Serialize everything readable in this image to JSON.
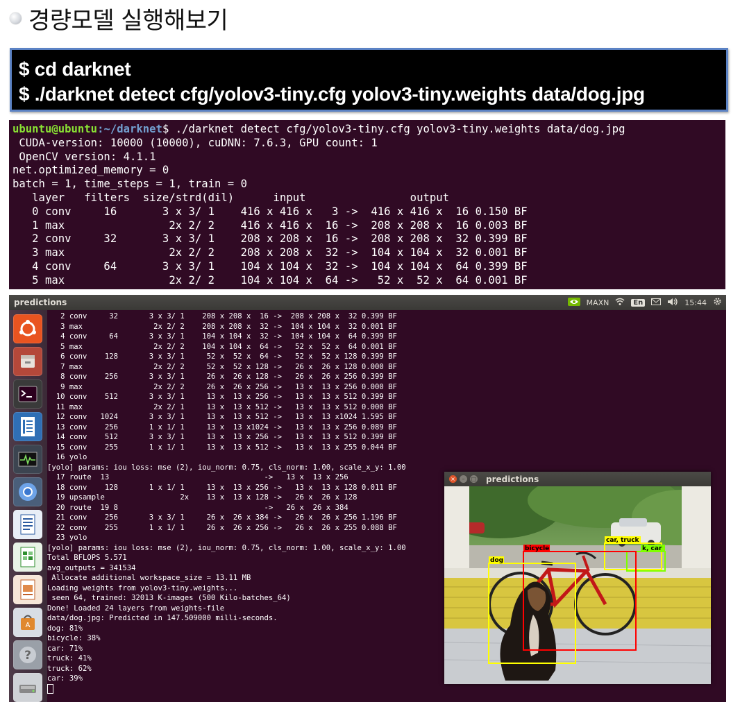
{
  "slide": {
    "title": "경량모델 실행해보기"
  },
  "command_box": {
    "lines": [
      "$ cd darknet",
      "$ ./darknet detect cfg/yolov3-tiny.cfg yolov3-tiny.weights data/dog.jpg"
    ]
  },
  "terminal1": {
    "prompt_user": "ubuntu@ubuntu",
    "prompt_path": ":~/darknet",
    "prompt_cmd": "$ ./darknet detect cfg/yolov3-tiny.cfg yolov3-tiny.weights data/dog.jpg",
    "lines": [
      " CUDA-version: 10000 (10000), cuDNN: 7.6.3, GPU count: 1",
      " OpenCV version: 4.1.1",
      "net.optimized_memory = 0",
      "batch = 1, time_steps = 1, train = 0",
      "   layer   filters  size/strd(dil)      input                output",
      "   0 conv     16       3 x 3/ 1    416 x 416 x   3 ->  416 x 416 x  16 0.150 BF",
      "   1 max                2x 2/ 2    416 x 416 x  16 ->  208 x 208 x  16 0.003 BF",
      "   2 conv     32       3 x 3/ 1    208 x 208 x  16 ->  208 x 208 x  32 0.399 BF",
      "   3 max                2x 2/ 2    208 x 208 x  32 ->  104 x 104 x  32 0.001 BF",
      "   4 conv     64       3 x 3/ 1    104 x 104 x  32 ->  104 x 104 x  64 0.399 BF",
      "   5 max                2x 2/ 2    104 x 104 x  64 ->   52 x  52 x  64 0.001 BF"
    ]
  },
  "desktop": {
    "topbar_title": "predictions",
    "tray": {
      "network_label": "MAXN",
      "keyboard_label": "En",
      "time": "15:44"
    },
    "launcher_items": [
      "ubuntu-icon",
      "files-icon",
      "terminal-icon",
      "text-editor-icon",
      "system-monitor-icon",
      "chromium-icon",
      "writer-icon",
      "calc-icon",
      "impress-icon",
      "software-center-icon",
      "help-icon",
      "drive-icon"
    ]
  },
  "terminal2": {
    "lines": [
      "   2 conv     32       3 x 3/ 1    208 x 208 x  16 ->  208 x 208 x  32 0.399 BF",
      "   3 max                2x 2/ 2    208 x 208 x  32 ->  104 x 104 x  32 0.001 BF",
      "   4 conv     64       3 x 3/ 1    104 x 104 x  32 ->  104 x 104 x  64 0.399 BF",
      "   5 max                2x 2/ 2    104 x 104 x  64 ->   52 x  52 x  64 0.001 BF",
      "   6 conv    128       3 x 3/ 1     52 x  52 x  64 ->   52 x  52 x 128 0.399 BF",
      "   7 max                2x 2/ 2     52 x  52 x 128 ->   26 x  26 x 128 0.000 BF",
      "   8 conv    256       3 x 3/ 1     26 x  26 x 128 ->   26 x  26 x 256 0.399 BF",
      "   9 max                2x 2/ 2     26 x  26 x 256 ->   13 x  13 x 256 0.000 BF",
      "  10 conv    512       3 x 3/ 1     13 x  13 x 256 ->   13 x  13 x 512 0.399 BF",
      "  11 max                2x 2/ 1     13 x  13 x 512 ->   13 x  13 x 512 0.000 BF",
      "  12 conv   1024       3 x 3/ 1     13 x  13 x 512 ->   13 x  13 x1024 1.595 BF",
      "  13 conv    256       1 x 1/ 1     13 x  13 x1024 ->   13 x  13 x 256 0.089 BF",
      "  14 conv    512       3 x 3/ 1     13 x  13 x 256 ->   13 x  13 x 512 0.399 BF",
      "  15 conv    255       1 x 1/ 1     13 x  13 x 512 ->   13 x  13 x 255 0.044 BF",
      "  16 yolo",
      "[yolo] params: iou loss: mse (2), iou_norm: 0.75, cls_norm: 1.00, scale_x_y: 1.00",
      "  17 route  13                                   ->   13 x  13 x 256",
      "  18 conv    128       1 x 1/ 1     13 x  13 x 256 ->   13 x  13 x 128 0.011 BF",
      "  19 upsample                 2x    13 x  13 x 128 ->   26 x  26 x 128",
      "  20 route  19 8                                 ->   26 x  26 x 384",
      "  21 conv    256       3 x 3/ 1     26 x  26 x 384 ->   26 x  26 x 256 1.196 BF",
      "  22 conv    255       1 x 1/ 1     26 x  26 x 256 ->   26 x  26 x 255 0.088 BF",
      "  23 yolo",
      "[yolo] params: iou loss: mse (2), iou_norm: 0.75, cls_norm: 1.00, scale_x_y: 1.00",
      "Total BFLOPS 5.571",
      "avg_outputs = 341534",
      " Allocate additional workspace_size = 13.11 MB",
      "Loading weights from yolov3-tiny.weights...",
      " seen 64, trained: 32013 K-images (500 Kilo-batches_64)",
      "Done! Loaded 24 layers from weights-file",
      "data/dog.jpg: Predicted in 147.509000 milli-seconds.",
      "dog: 81%",
      "bicycle: 38%",
      "car: 71%",
      "truck: 41%",
      "truck: 62%",
      "car: 39%"
    ]
  },
  "prediction_window": {
    "title": "predictions",
    "labels": {
      "dog": "dog",
      "bicycle": "bicycle",
      "car_truck": "car, truck",
      "truck_car": "k, car"
    },
    "colors": {
      "dog": "#ffff00",
      "bicycle": "#ff0000",
      "car_truck": "#ffff00",
      "truck_car": "#7fff00"
    }
  }
}
